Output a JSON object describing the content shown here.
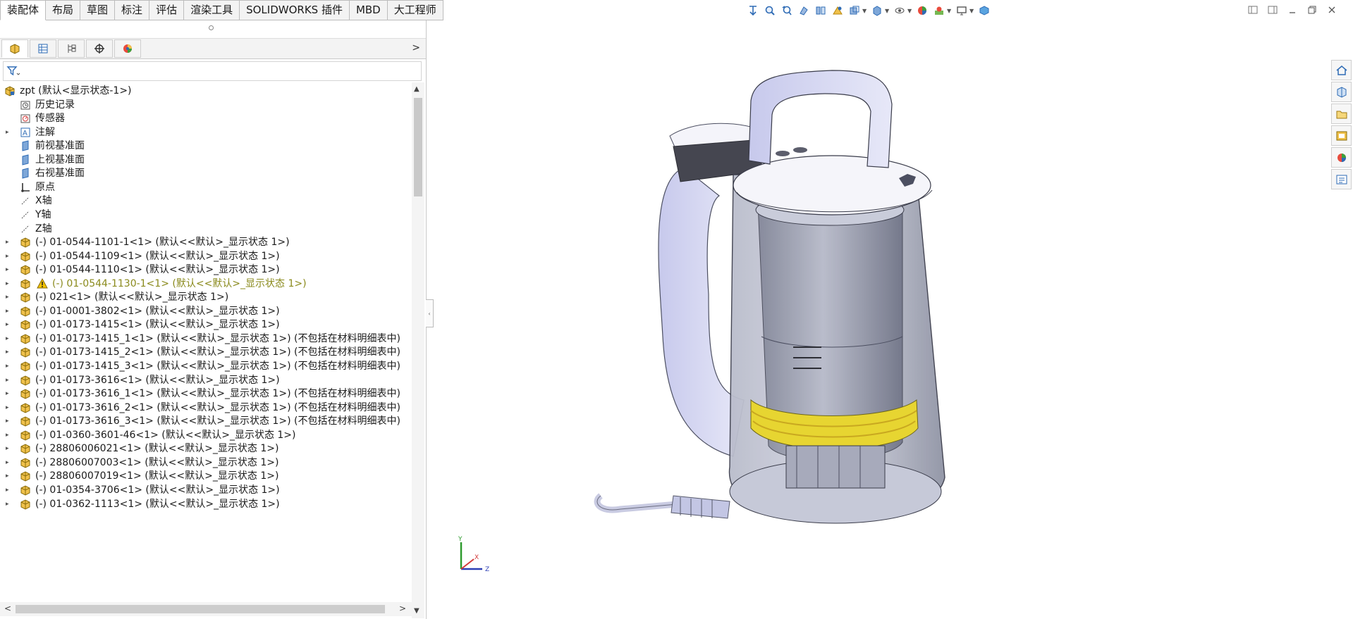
{
  "tabs": [
    "装配体",
    "布局",
    "草图",
    "标注",
    "评估",
    "渲染工具",
    "SOLIDWORKS 插件",
    "MBD",
    "大工程师"
  ],
  "active_tab": "装配体",
  "tree": {
    "root": "zpt  (默认<显示状态-1>)",
    "items": [
      {
        "label": "历史记录",
        "icon": "history-icon",
        "expand": false
      },
      {
        "label": "传感器",
        "icon": "sensor-icon",
        "expand": false
      },
      {
        "label": "注解",
        "icon": "annotation-icon",
        "expand": true
      },
      {
        "label": "前视基准面",
        "icon": "plane-icon",
        "expand": false
      },
      {
        "label": "上视基准面",
        "icon": "plane-icon",
        "expand": false
      },
      {
        "label": "右视基准面",
        "icon": "plane-icon",
        "expand": false
      },
      {
        "label": "原点",
        "icon": "origin-icon",
        "expand": false
      },
      {
        "label": "X轴",
        "icon": "axis-icon",
        "expand": false
      },
      {
        "label": "Y轴",
        "icon": "axis-icon",
        "expand": false
      },
      {
        "label": "Z轴",
        "icon": "axis-icon",
        "expand": false
      },
      {
        "label": "(-) 01-0544-1101-1<1> (默认<<默认>_显示状态 1>)",
        "icon": "part-icon",
        "expand": true
      },
      {
        "label": "(-) 01-0544-1109<1> (默认<<默认>_显示状态 1>)",
        "icon": "part-icon",
        "expand": true
      },
      {
        "label": "(-) 01-0544-1110<1> (默认<<默认>_显示状态 1>)",
        "icon": "part-icon",
        "expand": true
      },
      {
        "label": "(-) 01-0544-1130-1<1> (默认<<默认>_显示状态 1>)",
        "icon": "part-icon",
        "expand": true,
        "warning": true
      },
      {
        "label": "(-) 021<1> (默认<<默认>_显示状态 1>)",
        "icon": "part-icon",
        "expand": true
      },
      {
        "label": "(-) 01-0001-3802<1> (默认<<默认>_显示状态 1>)",
        "icon": "part-icon",
        "expand": true
      },
      {
        "label": "(-) 01-0173-1415<1> (默认<<默认>_显示状态 1>)",
        "icon": "part-icon",
        "expand": true
      },
      {
        "label": "(-) 01-0173-1415_1<1> (默认<<默认>_显示状态 1>) (不包括在材料明细表中)",
        "icon": "part-icon",
        "expand": true
      },
      {
        "label": "(-) 01-0173-1415_2<1> (默认<<默认>_显示状态 1>) (不包括在材料明细表中)",
        "icon": "part-icon",
        "expand": true
      },
      {
        "label": "(-) 01-0173-1415_3<1> (默认<<默认>_显示状态 1>) (不包括在材料明细表中)",
        "icon": "part-icon",
        "expand": true
      },
      {
        "label": "(-) 01-0173-3616<1> (默认<<默认>_显示状态 1>)",
        "icon": "part-icon",
        "expand": true
      },
      {
        "label": "(-) 01-0173-3616_1<1> (默认<<默认>_显示状态 1>) (不包括在材料明细表中)",
        "icon": "part-icon",
        "expand": true
      },
      {
        "label": "(-) 01-0173-3616_2<1> (默认<<默认>_显示状态 1>) (不包括在材料明细表中)",
        "icon": "part-icon",
        "expand": true
      },
      {
        "label": "(-) 01-0173-3616_3<1> (默认<<默认>_显示状态 1>) (不包括在材料明细表中)",
        "icon": "part-icon",
        "expand": true
      },
      {
        "label": "(-) 01-0360-3601-46<1> (默认<<默认>_显示状态 1>)",
        "icon": "part-icon",
        "expand": true
      },
      {
        "label": "(-) 28806006021<1> (默认<<默认>_显示状态 1>)",
        "icon": "part-icon",
        "expand": true
      },
      {
        "label": "(-) 28806007003<1> (默认<<默认>_显示状态 1>)",
        "icon": "part-icon",
        "expand": true
      },
      {
        "label": "(-) 28806007019<1> (默认<<默认>_显示状态 1>)",
        "icon": "part-icon",
        "expand": true
      },
      {
        "label": "(-) 01-0354-3706<1> (默认<<默认>_显示状态 1>)",
        "icon": "part-icon",
        "expand": true
      },
      {
        "label": "(-) 01-0362-1113<1> (默认<<默认>_显示状态 1>)",
        "icon": "part-icon",
        "expand": true
      }
    ]
  },
  "triad": {
    "x": "X",
    "y": "Y",
    "z": "Z"
  },
  "colors": {
    "accent": "#2e6bb5",
    "warning_text": "#8a8a1c",
    "yellow_ring": "#e7d531",
    "body_lilac": "#d9dcf2"
  }
}
